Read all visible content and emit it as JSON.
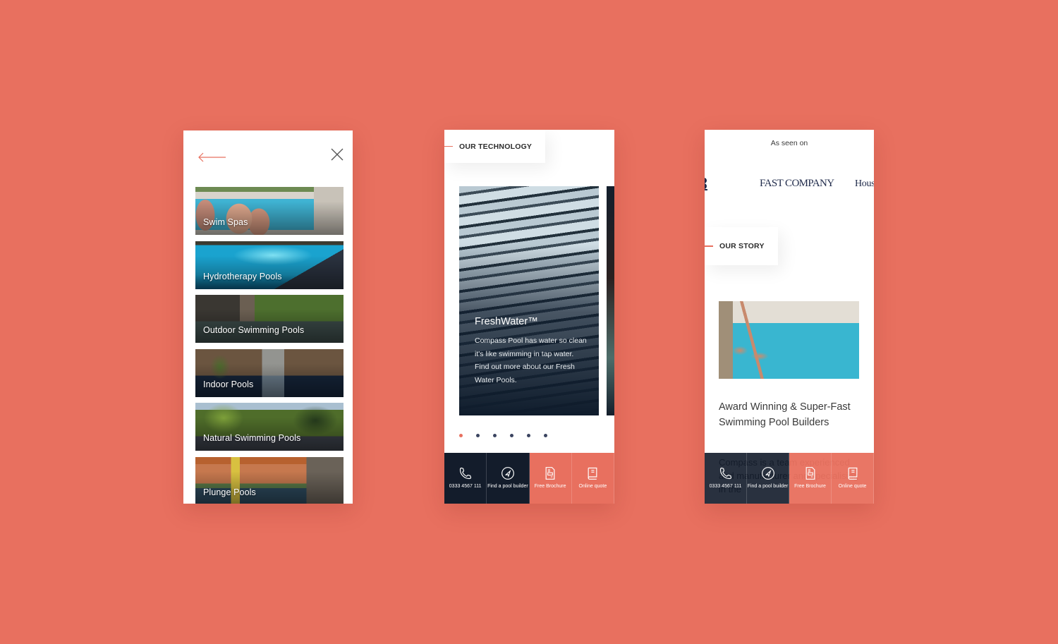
{
  "colors": {
    "background": "#E8705F",
    "accent": "#E8705F",
    "navy": "#131C2B"
  },
  "menu_screen": {
    "back_icon": "long-arrow-left-icon",
    "close_icon": "close-x-icon",
    "items": [
      {
        "label": "Swim Spas"
      },
      {
        "label": "Hydrotherapy Pools"
      },
      {
        "label": "Outdoor Swimming Pools"
      },
      {
        "label": "Indoor Pools"
      },
      {
        "label": "Natural Swimming Pools"
      },
      {
        "label": "Plunge Pools"
      }
    ]
  },
  "technology_screen": {
    "section_label": "OUR TECHNOLOGY",
    "slide": {
      "title": "FreshWater™",
      "body": "Compass Pool has water so clean it's like swimming in tap water. Find out more about our Fresh Water Pools."
    },
    "carousel": {
      "total": 6,
      "active_index": 0
    }
  },
  "story_screen": {
    "seen_on_label": "As seen on",
    "logos": [
      "FAST COMPANY",
      "House"
    ],
    "section_label": "OUR STORY",
    "heading": "Award Winning & Super-Fast Swimming Pool Builders",
    "body_partial": "Compass is a team experienced and manufacturer and specialising in the"
  },
  "action_bar": [
    {
      "icon": "phone-icon",
      "label": "0333 4567 111",
      "style": "dark"
    },
    {
      "icon": "navigation-icon",
      "label": "Find a pool builder",
      "style": "dark"
    },
    {
      "icon": "brochure-icon",
      "label": "Free Brochure",
      "style": "coral"
    },
    {
      "icon": "book-icon",
      "label": "Online quote",
      "style": "coral"
    }
  ]
}
